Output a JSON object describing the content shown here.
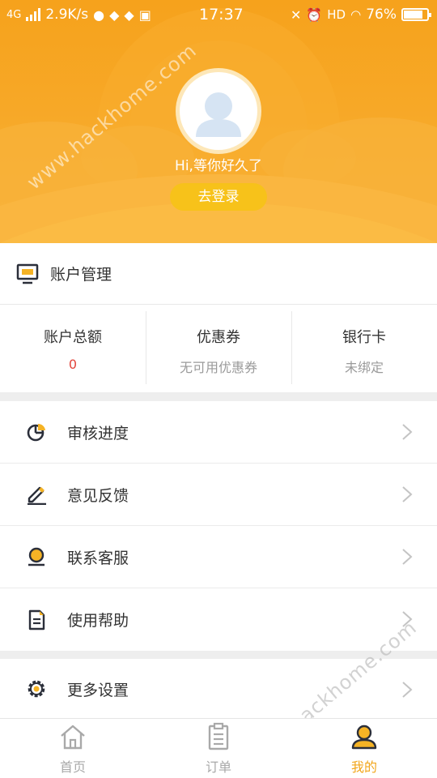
{
  "status_bar": {
    "network": "4G",
    "speed": "2.9K/s",
    "time": "17:37",
    "hd": "HD",
    "battery": "76%",
    "battery_level": 0.76
  },
  "profile": {
    "greeting": "Hi,等你好久了",
    "login_label": "去登录"
  },
  "account": {
    "title": "账户管理",
    "stats": [
      {
        "label": "账户总额",
        "value": "0"
      },
      {
        "label": "优惠券",
        "value": "无可用优惠券"
      },
      {
        "label": "银行卡",
        "value": "未绑定"
      }
    ]
  },
  "menu": [
    {
      "label": "审核进度",
      "icon": "pie-chart-icon"
    },
    {
      "label": "意见反馈",
      "icon": "pencil-icon"
    },
    {
      "label": "联系客服",
      "icon": "service-icon"
    },
    {
      "label": "使用帮助",
      "icon": "document-icon"
    }
  ],
  "menu2": [
    {
      "label": "更多设置",
      "icon": "gear-icon"
    }
  ],
  "tabs": [
    {
      "label": "首页",
      "icon": "home-icon",
      "active": false
    },
    {
      "label": "订单",
      "icon": "clipboard-icon",
      "active": false
    },
    {
      "label": "我的",
      "icon": "user-icon",
      "active": true
    }
  ],
  "watermark": "www.hackhome.com",
  "colors": {
    "accent": "#f6a21c",
    "button": "#f7c21a",
    "red": "#e2453c",
    "active_tab": "#f2a61b"
  }
}
